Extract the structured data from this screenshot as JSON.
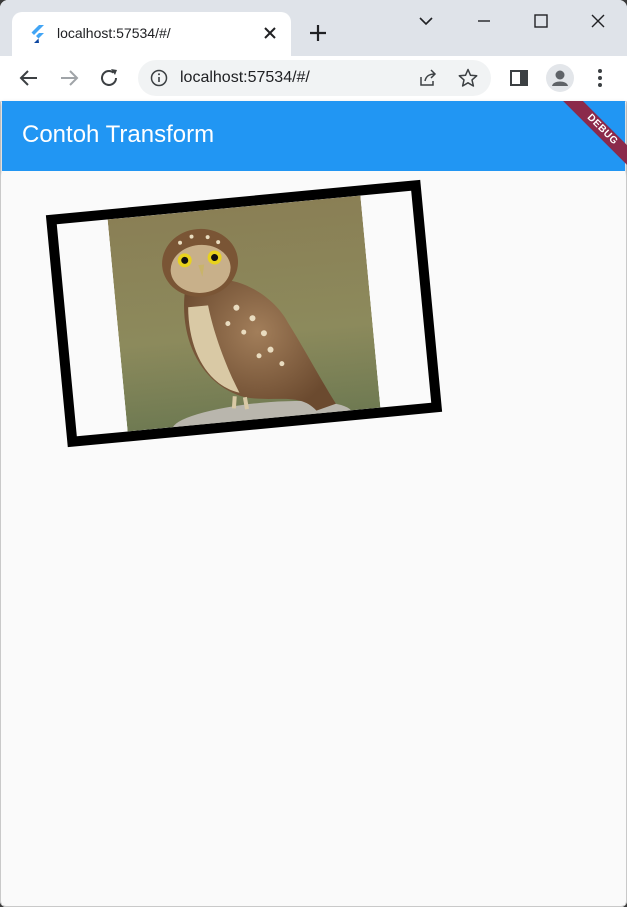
{
  "browser": {
    "tab_title": "localhost:57534/#/",
    "url": "localhost:57534/#/",
    "icons": [
      "flutter-favicon",
      "close-icon",
      "plus-icon",
      "chevron-down-icon",
      "minimize-icon",
      "maximize-icon",
      "close-window-icon",
      "back-arrow-icon",
      "forward-arrow-icon",
      "reload-icon",
      "info-icon",
      "share-icon",
      "star-icon",
      "sidebar-icon",
      "profile-icon",
      "kebab-menu-icon"
    ]
  },
  "app": {
    "title": "Contoh Transform",
    "debug_label": "DEBUG",
    "accent_color": "#2196f3",
    "banner_color": "#8b2a4b",
    "image_subject": "owl"
  }
}
